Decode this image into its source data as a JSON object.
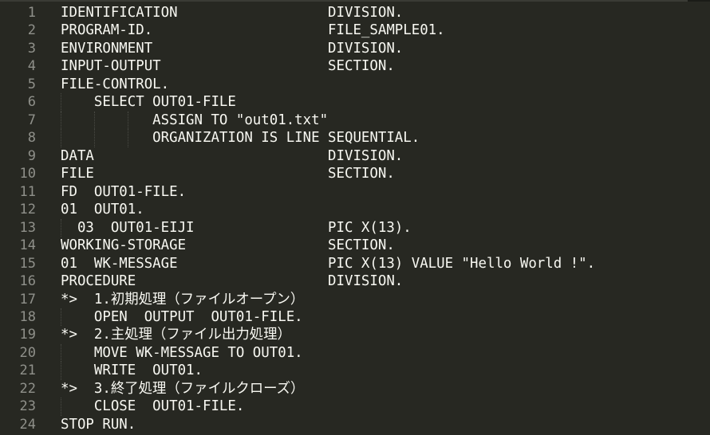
{
  "editor": {
    "theme_colors": {
      "background": "#272822",
      "text": "#f8f8f2",
      "line_number": "#8f908a",
      "indent_guide": "#4a4b45"
    },
    "lines": [
      {
        "n": "1",
        "text": "IDENTIFICATION                  DIVISION.",
        "guides": []
      },
      {
        "n": "2",
        "text": "PROGRAM-ID.                     FILE_SAMPLE01.",
        "guides": []
      },
      {
        "n": "3",
        "text": "ENVIRONMENT                     DIVISION.",
        "guides": []
      },
      {
        "n": "4",
        "text": "INPUT-OUTPUT                    SECTION.",
        "guides": []
      },
      {
        "n": "5",
        "text": "FILE-CONTROL.",
        "guides": []
      },
      {
        "n": "6",
        "text": "    SELECT OUT01-FILE",
        "guides": [
          0
        ]
      },
      {
        "n": "7",
        "text": "           ASSIGN TO \"out01.txt\"",
        "guides": [
          0,
          4,
          8
        ]
      },
      {
        "n": "8",
        "text": "           ORGANIZATION IS LINE SEQUENTIAL.",
        "guides": [
          0,
          4,
          8
        ]
      },
      {
        "n": "9",
        "text": "DATA                            DIVISION.",
        "guides": []
      },
      {
        "n": "10",
        "text": "FILE                            SECTION.",
        "guides": []
      },
      {
        "n": "11",
        "text": "FD  OUT01-FILE.",
        "guides": []
      },
      {
        "n": "12",
        "text": "01  OUT01.",
        "guides": []
      },
      {
        "n": "13",
        "text": "  03  OUT01-EIJI                PIC X(13).",
        "guides": [
          0
        ]
      },
      {
        "n": "14",
        "text": "WORKING-STORAGE                 SECTION.",
        "guides": []
      },
      {
        "n": "15",
        "text": "01  WK-MESSAGE                  PIC X(13) VALUE \"Hello World !\".",
        "guides": []
      },
      {
        "n": "16",
        "text": "PROCEDURE                       DIVISION.",
        "guides": []
      },
      {
        "n": "17",
        "text": "*>  1.初期処理（ファイルオープン）",
        "guides": []
      },
      {
        "n": "18",
        "text": "    OPEN  OUTPUT  OUT01-FILE.",
        "guides": [
          0
        ]
      },
      {
        "n": "19",
        "text": "*>  2.主処理（ファイル出力処理）",
        "guides": []
      },
      {
        "n": "20",
        "text": "    MOVE WK-MESSAGE TO OUT01.",
        "guides": [
          0
        ]
      },
      {
        "n": "21",
        "text": "    WRITE  OUT01.",
        "guides": [
          0
        ]
      },
      {
        "n": "22",
        "text": "*>  3.終了処理（ファイルクローズ）",
        "guides": []
      },
      {
        "n": "23",
        "text": "    CLOSE  OUT01-FILE.",
        "guides": [
          0
        ]
      },
      {
        "n": "24",
        "text": "STOP RUN.",
        "guides": []
      }
    ]
  }
}
